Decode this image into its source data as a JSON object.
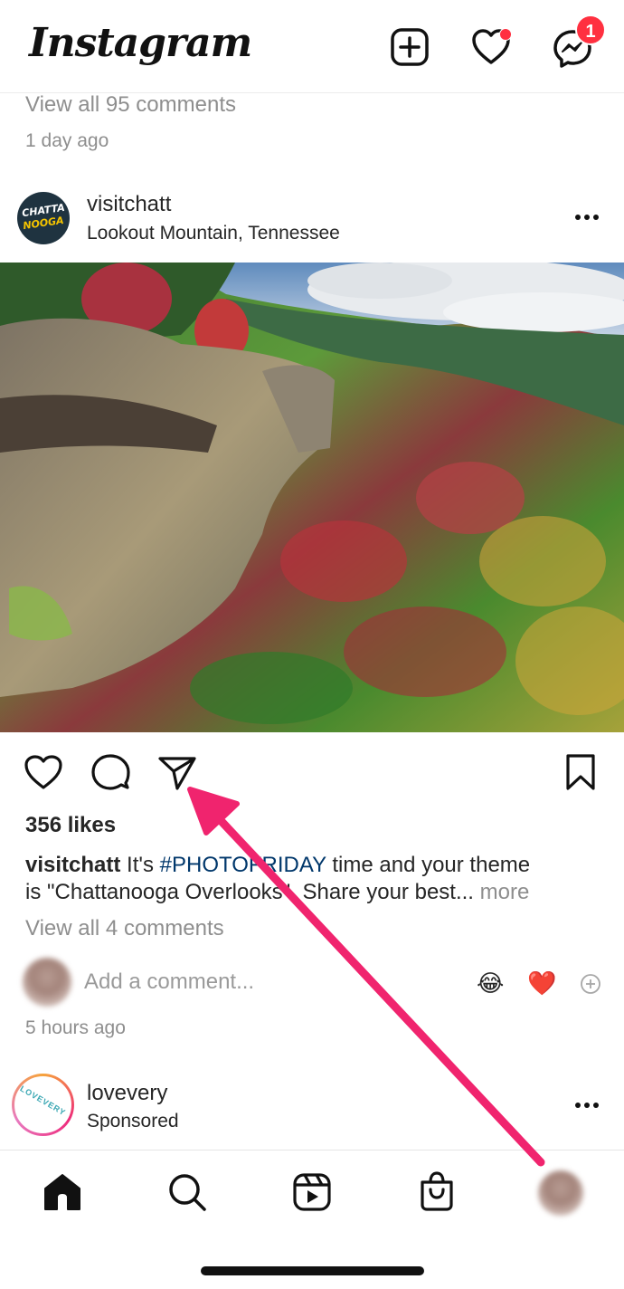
{
  "header": {
    "logo_text": "Instagram",
    "messenger_badge": "1"
  },
  "prev_post": {
    "view_comments": "View all 95 comments",
    "time": "1 day ago"
  },
  "post": {
    "username": "visitchatt",
    "location": "Lookout Mountain, Tennessee",
    "avatar_text_1": "CHATTA",
    "avatar_text_2": "NOOGA",
    "likes": "356 likes",
    "caption_user": "visitchatt",
    "caption_before": "It's",
    "hashtag": "#PHOTOFRIDAY",
    "caption_after": "time and your theme",
    "caption_line2": "is \"Chattanooga Overlooks\". Share your best...",
    "more": "more",
    "view_comments": "View all 4 comments",
    "add_comment_placeholder": "Add a comment...",
    "emoji_1": "😂",
    "emoji_2": "❤️",
    "time": "5 hours ago"
  },
  "next_post": {
    "username": "lovevery",
    "subtitle": "Sponsored",
    "avatar_text": "LOVEVERY"
  },
  "colors": {
    "badge": "#ff3040",
    "annotation_arrow": "#f0246e",
    "hashtag": "#00376b"
  }
}
